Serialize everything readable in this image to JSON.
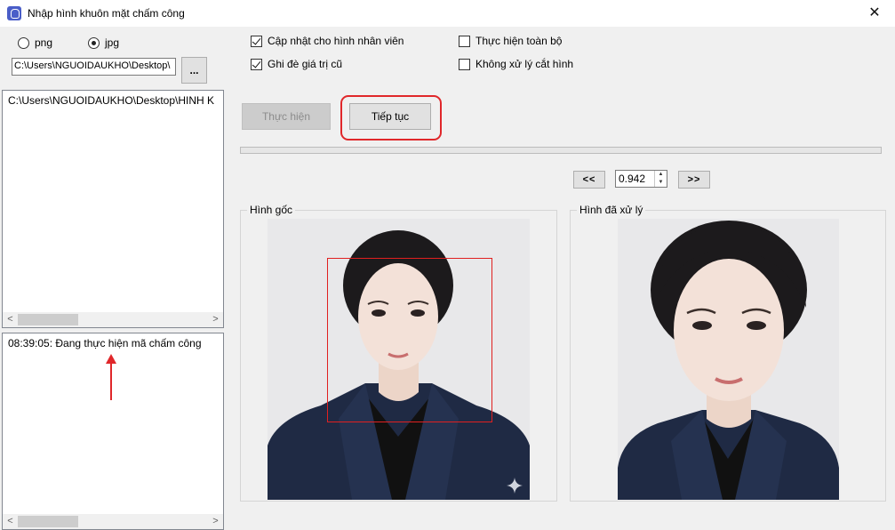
{
  "window": {
    "title": "Nhập hình khuôn mặt chấm công",
    "close_glyph": "✕",
    "icon": "face-scan-icon"
  },
  "format": {
    "options": [
      {
        "label": "png",
        "selected": false
      },
      {
        "label": "jpg",
        "selected": true
      }
    ]
  },
  "source": {
    "path": "C:\\Users\\NGUOIDAUKHO\\Desktop\\",
    "browse_label": "..."
  },
  "file_list": {
    "items": [
      "C:\\Users\\NGUOIDAUKHO\\Desktop\\HINH K"
    ]
  },
  "log": {
    "lines": [
      "08:39:05: Đang thực hiện mã chấm công"
    ]
  },
  "options": {
    "update_employee_image": {
      "label": "Cập nhật cho hình nhân viên",
      "checked": true
    },
    "overwrite_old_value": {
      "label": "Ghi đè giá trị cũ",
      "checked": true
    },
    "process_all": {
      "label": "Thực hiện toàn bộ",
      "checked": false
    },
    "no_crop": {
      "label": "Không xử lý cắt hình",
      "checked": false
    }
  },
  "actions": {
    "run_label": "Thực hiện",
    "continue_label": "Tiếp tục"
  },
  "navigator": {
    "prev_label": "<<",
    "next_label": ">>",
    "threshold_value": "0.942",
    "up_glyph": "▲",
    "down_glyph": "▼"
  },
  "panels": {
    "original_label": "Hình gốc",
    "processed_label": "Hình đã xử lý"
  },
  "scrollbar": {
    "left_glyph": "<",
    "right_glyph": ">"
  },
  "colors": {
    "annotation_red": "#e0272a",
    "face_box": "#e02020",
    "suit": "#1f2a44",
    "photo_bg": "#e8e8ea"
  }
}
